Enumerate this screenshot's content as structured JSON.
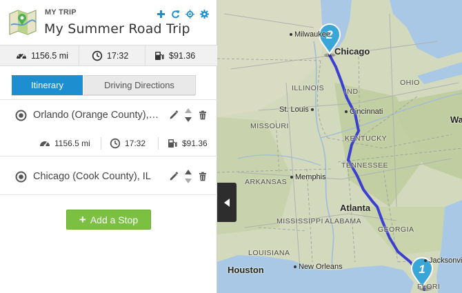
{
  "header": {
    "kicker": "MY TRIP",
    "title": "My Summer Road Trip",
    "tools": [
      "add-icon",
      "refresh-icon",
      "locate-icon",
      "settings-icon"
    ],
    "accent": "#1d8fd1"
  },
  "trip_stats": {
    "distance": "1156.5 mi",
    "time": "17:32",
    "cost": "$91.36"
  },
  "tabs": [
    {
      "label": "Itinerary",
      "active": true
    },
    {
      "label": "Driving Directions",
      "active": false
    }
  ],
  "stops": [
    {
      "name": "Orlando (Orange County), FL",
      "leg": {
        "distance": "1156.5 mi",
        "time": "17:32",
        "cost": "$91.36"
      }
    },
    {
      "name": "Chicago (Cook County), IL"
    }
  ],
  "add_stop_label": "Add a Stop",
  "add_stop_color": "#7cc041",
  "map": {
    "route_color": "#3b3fd0",
    "markers": [
      "1",
      "2"
    ],
    "labels": {
      "milwaukee": "Milwaukee",
      "chicago": "Chicago",
      "illinois": "ILLINOIS",
      "indiana": "IND",
      "ohio": "OHIO",
      "st_louis": "St. Louis",
      "cincinnati": "Cincinnati",
      "missouri": "MISSOURI",
      "kentucky": "KENTUCKY",
      "wa": "Wa",
      "tennessee": "TENNESSEE",
      "arkansas": "ARKANSAS",
      "memphis": "Memphis",
      "atlanta": "Atlanta",
      "mississippi": "MISSISSIPPI",
      "alabama": "ALABAMA",
      "georgia": "GEORGIA",
      "louisiana": "LOUISIANA",
      "houston": "Houston",
      "new_orleans": "New Orleans",
      "jacksonville": "Jacksonville",
      "florida": "FLORI"
    }
  }
}
